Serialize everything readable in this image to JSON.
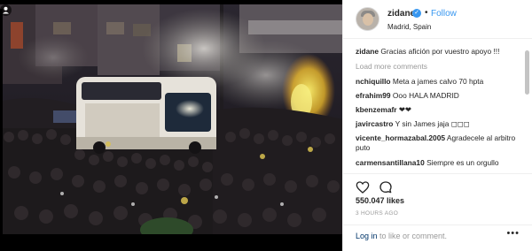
{
  "header": {
    "username": "zidane",
    "verified_symbol": "✓",
    "separator": "•",
    "follow_label": "Follow",
    "location": "Madrid, Spain"
  },
  "comments": {
    "caption": {
      "user": "zidane",
      "text": "Gracias afición por vuestro apoyo !!!"
    },
    "load_more": "Load more comments",
    "items": [
      {
        "user": "nchiquillo",
        "text": "Meta a james calvo 70 hpta"
      },
      {
        "user": "efrahim99",
        "text": "Ooo HALA MADRID"
      },
      {
        "user": "kbenzemafr",
        "text": "❤❤"
      },
      {
        "user": "javircastro",
        "text": "Y sin James jaja ◻◻◻"
      },
      {
        "user": "vicente_hormazabal.2005",
        "text": "Agradecele al arbitro puto"
      },
      {
        "user": "carmensantillana10",
        "text": "Siempre es un orgullo"
      }
    ]
  },
  "actions": {
    "like_icon": "heart-icon",
    "comment_icon": "comment-icon"
  },
  "likes": "550.047 likes",
  "timestamp": "3 HOURS AGO",
  "footer": {
    "login_link": "Log in",
    "login_rest": " to like or comment.",
    "more_label": "•••"
  },
  "media": {
    "corner_icon": "user-tag-icon"
  },
  "colors": {
    "link": "#3897f0",
    "muted": "#999999",
    "text": "#262626",
    "border": "#efefef"
  }
}
